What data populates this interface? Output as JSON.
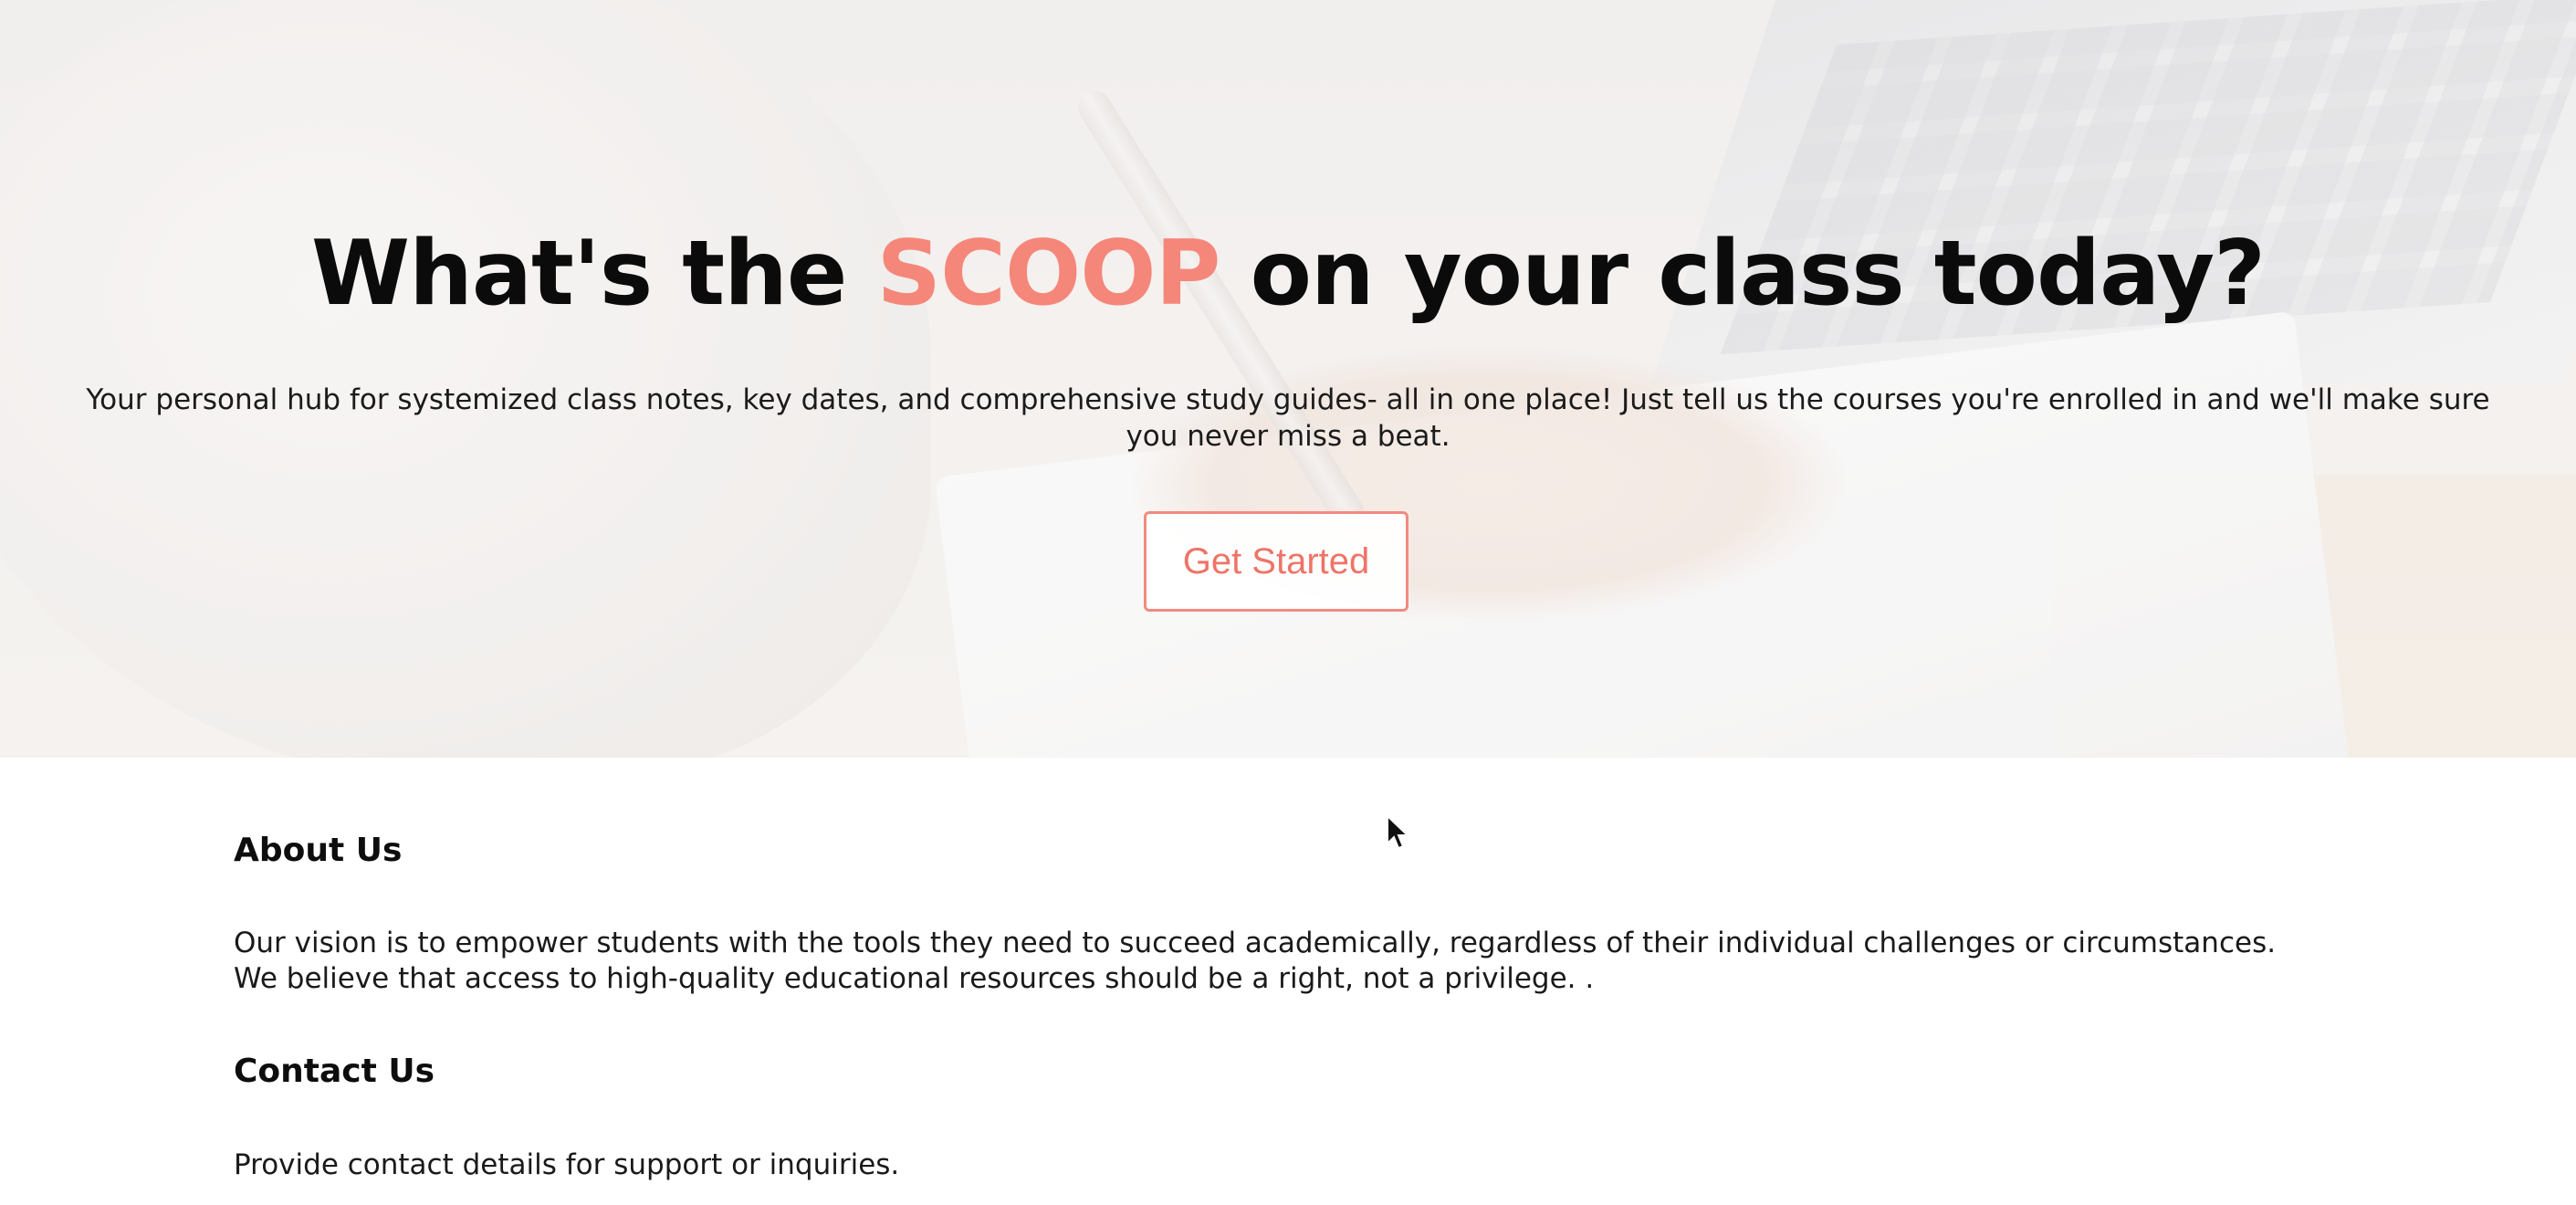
{
  "hero": {
    "title_before": "What's the",
    "title_accent": "SCOOP",
    "title_after": "on your class today?",
    "subtitle_line1": "Your personal hub for systemized class notes, key dates, and comprehensive study guides- all in one place! Just tell us the courses you're enrolled in and we'll make sure",
    "subtitle_line2": "you never miss a beat.",
    "cta_label": "Get Started"
  },
  "about": {
    "heading": "About Us",
    "line1": "Our vision is to empower students with the tools they need to succeed academically, regardless of their individual challenges or circumstances.",
    "line2": "We believe that access to high-quality educational resources should be a right, not a privilege. ."
  },
  "contact": {
    "heading": "Contact Us",
    "text": "Provide contact details for support or inquiries."
  },
  "colors": {
    "accent": "#f5877a",
    "text": "#111111",
    "background": "#ffffff"
  },
  "icons": {
    "cursor": "mouse-pointer-icon"
  }
}
